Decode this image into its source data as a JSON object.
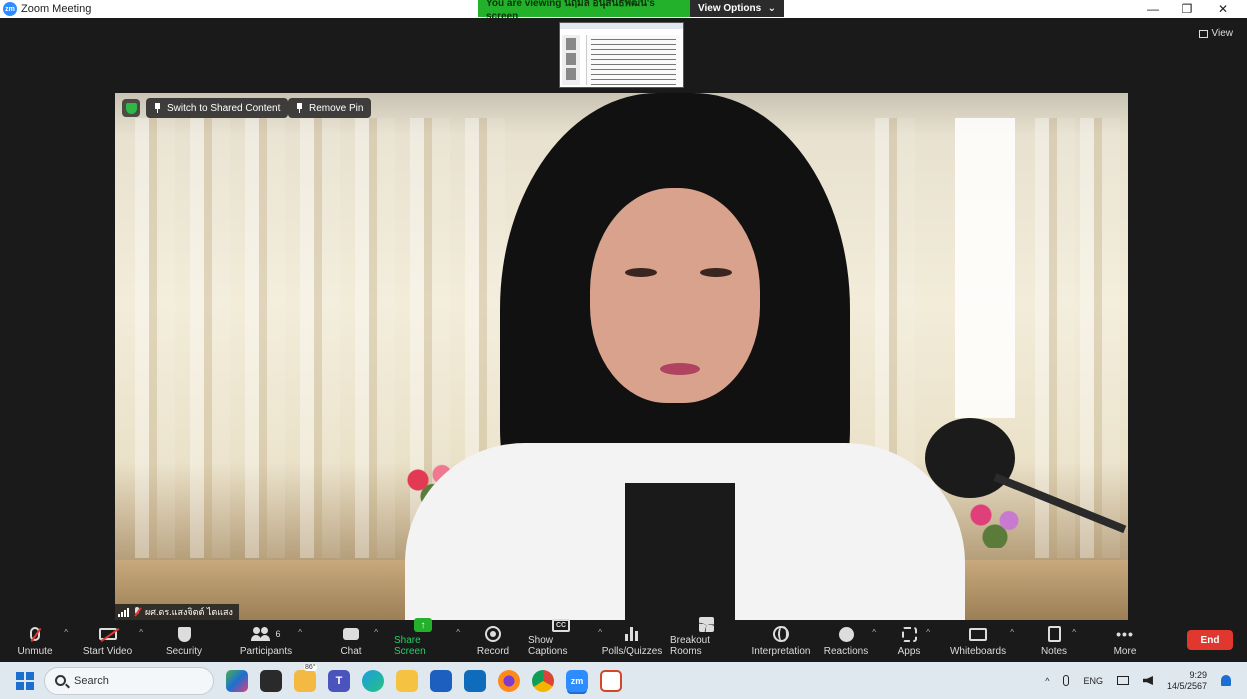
{
  "window": {
    "title": "Zoom Meeting",
    "app_icon_text": "zm",
    "controls": [
      "—",
      "❐",
      "✕"
    ]
  },
  "share_banner": {
    "viewing_text": "You are viewing นฤมล อนุสนธิ์พัฒน์'s screen",
    "view_options_label": "View Options",
    "view_options_caret": "⌄"
  },
  "stage": {
    "view_label": "View"
  },
  "video_overlay": {
    "switch_label": "Switch to Shared Content",
    "remove_pin_label": "Remove Pin",
    "participant_name": "ผศ.ดร.แสงจิตต์ ไตแสง"
  },
  "toolbar": {
    "caret": "^",
    "participants_count": "6",
    "cc_text": "CC",
    "share_arrow": "↑",
    "more_glyph": "•••",
    "items": [
      {
        "label": "Unmute"
      },
      {
        "label": "Start Video"
      },
      {
        "label": "Security"
      },
      {
        "label": "Participants"
      },
      {
        "label": "Chat"
      },
      {
        "label": "Share Screen"
      },
      {
        "label": "Record"
      },
      {
        "label": "Show Captions"
      },
      {
        "label": "Polls/Quizzes"
      },
      {
        "label": "Breakout Rooms"
      },
      {
        "label": "Interpretation"
      },
      {
        "label": "Reactions"
      },
      {
        "label": "Apps"
      },
      {
        "label": "Whiteboards"
      },
      {
        "label": "Notes"
      },
      {
        "label": "More"
      }
    ],
    "end_label": "End"
  },
  "taskbar": {
    "search_placeholder": "Search",
    "weather_temp": "86°",
    "teams_letter": "T",
    "zoom_letters": "zm",
    "tray_caret": "^",
    "lang": "ENG",
    "time": "9:29",
    "date": "14/5/2567"
  }
}
